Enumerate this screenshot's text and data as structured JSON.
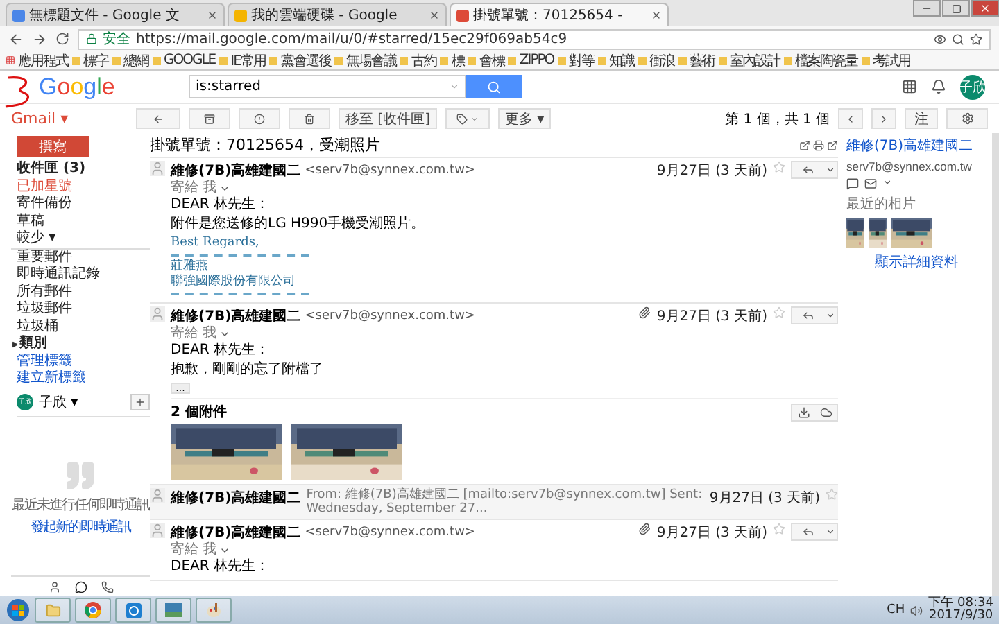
{
  "browser": {
    "tabs": [
      {
        "title": "無標題文件 - Google 文",
        "selected": false
      },
      {
        "title": "我的雲端硬碟 - Google",
        "selected": false
      },
      {
        "title": "掛號單號：70125654 -",
        "selected": true
      }
    ],
    "security_label": "安全",
    "url": "https://mail.google.com/mail/u/0/#starred/15ec29f069ab54c9",
    "bookmarks": [
      "應用程式",
      "標字",
      "總網",
      "GOOGLE",
      "IE常用",
      "黨會選後",
      "無場會議",
      "古約",
      "標",
      "會標",
      "ZIPPO",
      "對等",
      "知識",
      "衝浪",
      "藝術",
      "室內設計",
      "檔案陶瓷量",
      "考試用"
    ]
  },
  "gmail": {
    "logo": "Google",
    "search": {
      "value": "is:starred"
    },
    "avatar": "子欣",
    "app_label": "Gmail ▾",
    "toolbar": {
      "move_button": "移至 [收件匣]",
      "more_button": "更多 ▾",
      "pager": "第 1 個，共 1 個",
      "input_button": "注"
    },
    "compose": "撰寫",
    "nav": [
      {
        "kind": "folder",
        "label": "收件匣 (3)",
        "selected": false,
        "unread": true
      },
      {
        "kind": "folder",
        "label": "已加星號",
        "selected": true,
        "unread": false
      },
      {
        "kind": "folder",
        "label": "寄件備份",
        "selected": false,
        "unread": false
      },
      {
        "kind": "folder",
        "label": "草稿",
        "selected": false,
        "unread": false
      },
      {
        "kind": "toggle",
        "label": "較少 ▾",
        "selected": false,
        "unread": false
      },
      {
        "kind": "folder",
        "label": "重要郵件",
        "selected": false,
        "unread": false
      },
      {
        "kind": "folder",
        "label": "即時通訊記錄",
        "selected": false,
        "unread": false
      },
      {
        "kind": "folder",
        "label": "所有郵件",
        "selected": false,
        "unread": false
      },
      {
        "kind": "folder",
        "label": "垃圾郵件",
        "selected": false,
        "unread": false
      },
      {
        "kind": "folder",
        "label": "垃圾桶",
        "selected": false,
        "unread": false
      },
      {
        "kind": "category",
        "label": "類別",
        "selected": false,
        "unread": true
      },
      {
        "kind": "link",
        "label": "管理標籤",
        "selected": false,
        "unread": false
      },
      {
        "kind": "link",
        "label": "建立新標籤",
        "selected": false,
        "unread": false
      }
    ],
    "user": {
      "avatar": "子欣",
      "name": "子欣 ▾"
    },
    "hangouts": {
      "empty_text": "最近未進行任何即時通訊",
      "start_link": "發起新的即時通訊"
    },
    "thread": {
      "subject": "掛號單號：70125654，受潮照片",
      "messages": [
        {
          "kind": "expanded",
          "sender": "維修(7B)高雄建國二",
          "email": "<serv7b@synnex.com.tw>",
          "recipient": "寄給 我",
          "date": "9月27日 (3 天前)",
          "has_attachment": false,
          "body": [
            {
              "kind": "text",
              "text": "DEAR 林先生："
            },
            {
              "kind": "text",
              "text": "附件是您送修的LG H990手機受潮照片。"
            },
            {
              "kind": "signature",
              "text": "Best Regards,"
            },
            {
              "kind": "rule"
            },
            {
              "kind": "signature",
              "text": "莊雅燕"
            },
            {
              "kind": "signature",
              "text": "聯強國際股份有限公司"
            },
            {
              "kind": "rule"
            }
          ]
        },
        {
          "kind": "expanded",
          "sender": "維修(7B)高雄建國二",
          "email": "<serv7b@synnex.com.tw>",
          "recipient": "寄給 我",
          "date": "9月27日 (3 天前)",
          "has_attachment": true,
          "body": [
            {
              "kind": "text",
              "text": "DEAR 林先生："
            },
            {
              "kind": "text",
              "text": "抱歉，剛剛的忘了附檔了"
            },
            {
              "kind": "trimmed",
              "text": "..."
            }
          ],
          "attachments": {
            "count_label": "2 個附件"
          }
        },
        {
          "kind": "collapsed",
          "sender": "維修(7B)高雄建國二",
          "snippet": "From: 維修(7B)高雄建國二 [mailto:serv7b@synnex.com.tw] Sent: Wednesday, September 27...",
          "date": "9月27日 (3 天前)"
        },
        {
          "kind": "expanded",
          "sender": "維修(7B)高雄建國二",
          "email": "<serv7b@synnex.com.tw>",
          "recipient": "寄給 我",
          "date": "9月27日 (3 天前)",
          "has_attachment": true,
          "body": [
            {
              "kind": "text",
              "text": "DEAR 林先生："
            }
          ]
        }
      ]
    },
    "contact": {
      "name": "維修(7B)高雄建國二",
      "email": "serv7b@synnex.com.tw",
      "photos_label": "最近的相片",
      "details_link": "顯示詳細資料"
    }
  },
  "taskbar": {
    "ime": "CH",
    "time": "下午 08:34",
    "date": "2017/9/30"
  }
}
